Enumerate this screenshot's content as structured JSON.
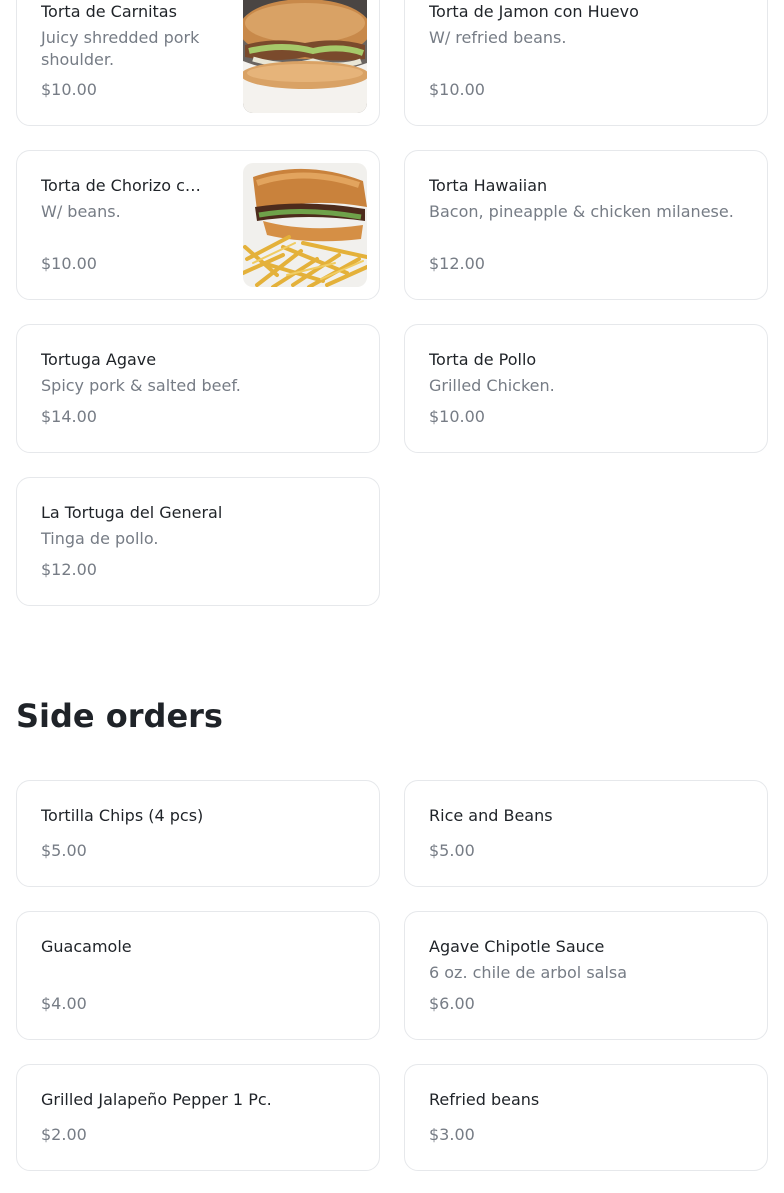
{
  "tortas": [
    {
      "name": "Torta de Carnitas",
      "desc": "Juicy shredded pork shoulder.",
      "price": "$10.00",
      "image": "sandwich-photo"
    },
    {
      "name": "Torta de Jamon con Huevo",
      "desc": "W/ refried beans.",
      "price": "$10.00"
    },
    {
      "name": "Torta de Chorizo c…",
      "desc": "W/ beans.",
      "price": "$10.00",
      "image": "sandwich-fries-photo"
    },
    {
      "name": "Torta Hawaiian",
      "desc": "Bacon, pineapple & chicken milanese.",
      "price": "$12.00"
    },
    {
      "name": "Tortuga Agave",
      "desc": "Spicy pork & salted beef.",
      "price": "$14.00"
    },
    {
      "name": "Torta de Pollo",
      "desc": "Grilled Chicken.",
      "price": "$10.00"
    },
    {
      "name": "La Tortuga del General",
      "desc": "Tinga de pollo.",
      "price": "$12.00"
    }
  ],
  "side_orders": {
    "title": "Side orders",
    "items": [
      {
        "name": "Tortilla Chips (4 pcs)",
        "price": "$5.00"
      },
      {
        "name": "Rice and Beans",
        "price": "$5.00"
      },
      {
        "name": "Guacamole",
        "desc": "",
        "price": "$4.00"
      },
      {
        "name": "Agave Chipotle Sauce",
        "desc": "6 oz. chile de arbol salsa",
        "price": "$6.00"
      },
      {
        "name": "Grilled Jalapeño Pepper 1 Pc.",
        "price": "$2.00"
      },
      {
        "name": "Refried beans",
        "price": "$3.00"
      }
    ]
  },
  "colors": {
    "text": "#1f2328",
    "muted": "#767c85",
    "border": "#e6e8eb"
  }
}
